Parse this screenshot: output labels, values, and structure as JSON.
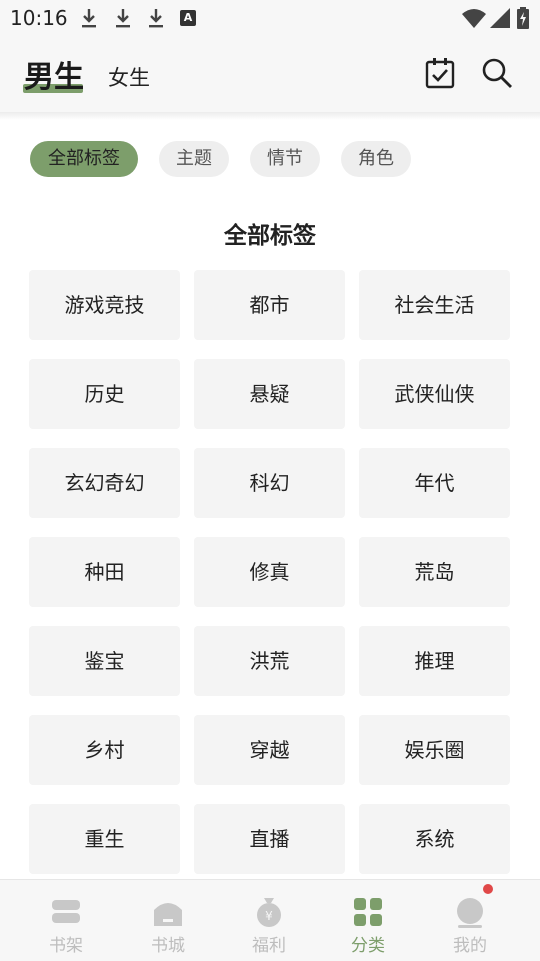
{
  "status_bar": {
    "time": "10:16",
    "a_badge": "A"
  },
  "header": {
    "tab_male": "男生",
    "tab_female": "女生"
  },
  "filters": [
    "全部标签",
    "主题",
    "情节",
    "角色"
  ],
  "section_title": "全部标签",
  "tags": [
    "游戏竞技",
    "都市",
    "社会生活",
    "历史",
    "悬疑",
    "武侠仙侠",
    "玄幻奇幻",
    "科幻",
    "年代",
    "种田",
    "修真",
    "荒岛",
    "鉴宝",
    "洪荒",
    "推理",
    "乡村",
    "穿越",
    "娱乐圈",
    "重生",
    "直播",
    "系统"
  ],
  "bottom_nav": [
    {
      "label": "书架",
      "icon": "bookshelf-icon"
    },
    {
      "label": "书城",
      "icon": "bookstore-icon"
    },
    {
      "label": "福利",
      "icon": "money-bag-icon"
    },
    {
      "label": "分类",
      "icon": "category-grid-icon"
    },
    {
      "label": "我的",
      "icon": "profile-icon"
    }
  ],
  "colors": {
    "accent": "#7d9e6b",
    "badge": "#e04848",
    "inactive": "#bdbdbd"
  }
}
